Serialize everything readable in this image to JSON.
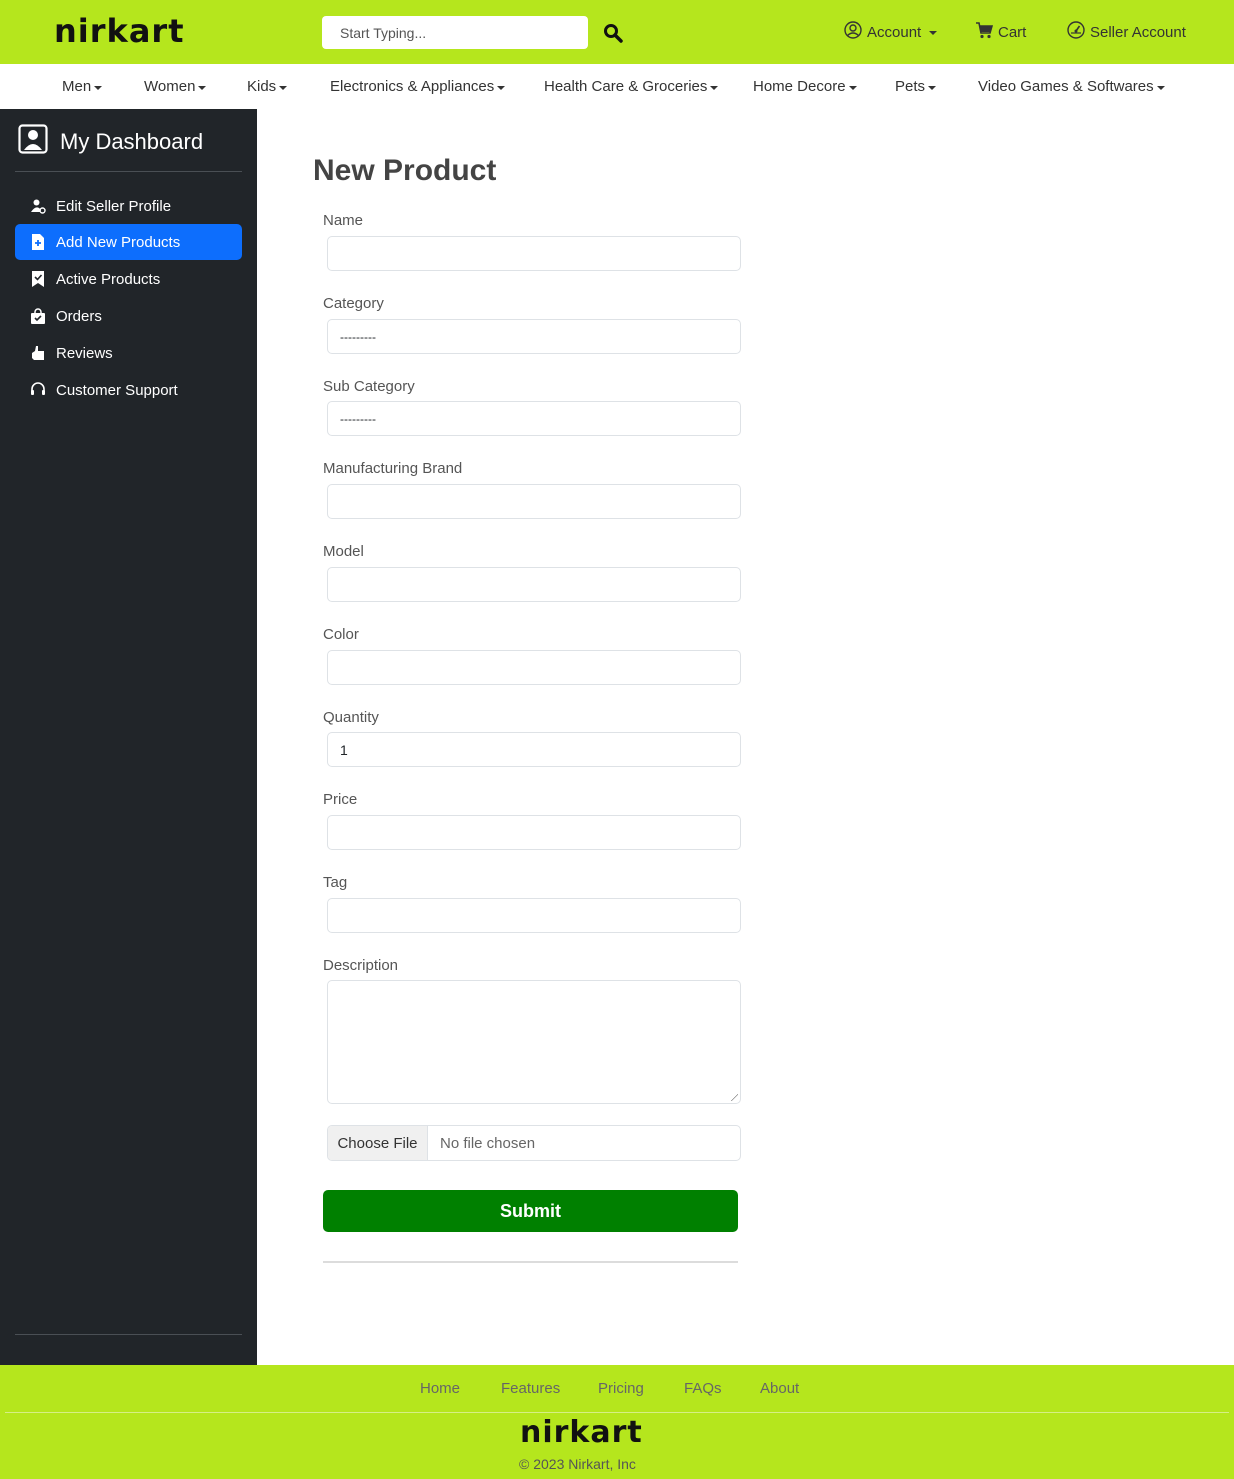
{
  "header": {
    "logo": "nirkart",
    "search_placeholder": "Start Typing...",
    "account_label": "Account",
    "cart_label": "Cart",
    "seller_label": "Seller Account"
  },
  "categories": [
    "Men",
    "Women",
    "Kids",
    "Electronics & Appliances",
    "Health Care & Groceries",
    "Home Decore",
    "Pets",
    "Video Games & Softwares"
  ],
  "sidebar": {
    "title": "My Dashboard",
    "items": [
      {
        "label": "Edit Seller Profile",
        "icon": "user-gear-icon"
      },
      {
        "label": "Add New Products",
        "icon": "file-plus-icon",
        "active": true
      },
      {
        "label": "Active Products",
        "icon": "bookmark-check-icon"
      },
      {
        "label": "Orders",
        "icon": "bag-check-icon"
      },
      {
        "label": "Reviews",
        "icon": "thumbs-up-icon"
      },
      {
        "label": "Customer Support",
        "icon": "headset-icon"
      }
    ]
  },
  "form": {
    "title": "New Product",
    "name_label": "Name",
    "category_label": "Category",
    "category_value": "---------",
    "subcategory_label": "Sub Category",
    "subcategory_value": "---------",
    "brand_label": "Manufacturing Brand",
    "model_label": "Model",
    "color_label": "Color",
    "quantity_label": "Quantity",
    "quantity_value": "1",
    "price_label": "Price",
    "tag_label": "Tag",
    "description_label": "Description",
    "file_button": "Choose File",
    "file_status": "No file chosen",
    "submit_label": "Submit"
  },
  "footer": {
    "links": [
      "Home",
      "Features",
      "Pricing",
      "FAQs",
      "About"
    ],
    "logo": "nirkart",
    "copyright": "© 2023 Nirkart, Inc"
  },
  "colors": {
    "brand_green": "#b5e61d",
    "sidebar_bg": "#212529",
    "active_blue": "#0d6efd",
    "submit_green": "#008000"
  }
}
